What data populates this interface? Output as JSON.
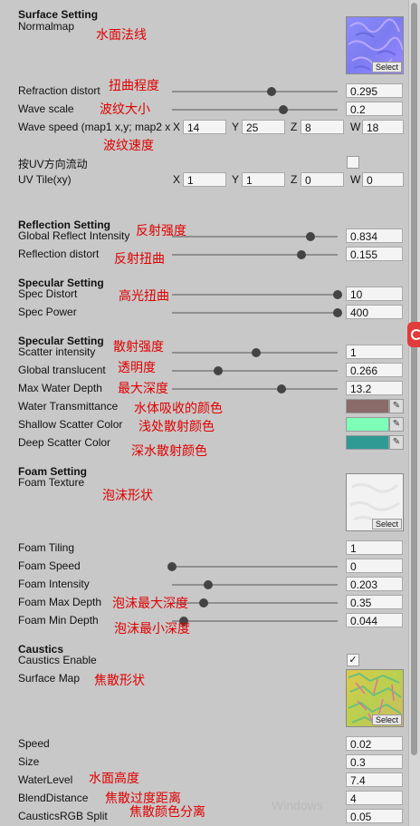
{
  "surface": {
    "header": "Surface Setting",
    "normalmap_label": "Normalmap",
    "normalmap_note": "水面法线",
    "select": "Select",
    "refraction": {
      "label": "Refraction distort",
      "note": "扭曲程度",
      "value": "0.295",
      "level": 0.6
    },
    "wave_scale": {
      "label": "Wave scale",
      "note": "波纹大小",
      "value": "0.2",
      "level": 0.67
    },
    "wave_speed": {
      "label": "Wave speed (map1 x,y; map2 x",
      "note": "波纹速度",
      "x": "14",
      "y": "25",
      "z": "8",
      "w": "18"
    },
    "uv_flow": {
      "label": "按UV方向流动"
    },
    "uv_tile": {
      "label": "UV Tile(xy)",
      "x": "1",
      "y": "1",
      "z": "0",
      "w": "0"
    },
    "axes": {
      "x": "X",
      "y": "Y",
      "z": "Z",
      "w": "W"
    }
  },
  "reflection": {
    "header": "Reflection Setting",
    "global": {
      "label": "Global Reflect Intensity",
      "note": "反射强度",
      "value": "0.834",
      "level": 0.834
    },
    "distort": {
      "label": "Reflection distort",
      "note": "反射扭曲",
      "value": "0.155",
      "level": 0.78
    }
  },
  "specular1": {
    "header": "Specular Setting",
    "distort": {
      "label": "Spec Distort",
      "note": "高光扭曲",
      "value": "10",
      "level": 1.0
    },
    "power": {
      "label": "Spec Power",
      "value": "400",
      "level": 1.0
    }
  },
  "specular2": {
    "header": "Specular Setting",
    "scatter": {
      "label": "Scatter intensity",
      "note": "散射强度",
      "value": "1",
      "level": 0.51
    },
    "translucent": {
      "label": "Global translucent",
      "note": "透明度",
      "value": "0.266",
      "level": 0.28
    },
    "depth": {
      "label": "Max Water Depth",
      "note": "最大深度",
      "value": "13.2",
      "level": 0.66
    },
    "transmit": {
      "label": "Water Transmittance",
      "note": "水体吸收的颜色",
      "color": "#8b6a6a"
    },
    "shallow": {
      "label": "Shallow Scatter Color",
      "note": "浅处散射颜色",
      "color": "#7dffb8"
    },
    "deep": {
      "label": "Deep Scatter Color",
      "note": "深水散射颜色",
      "color": "#2e9a93"
    }
  },
  "foam": {
    "header": "Foam Setting",
    "texture_label": "Foam Texture",
    "texture_note": "泡沫形状",
    "tiling": {
      "label": "Foam Tiling",
      "value": "1"
    },
    "speed": {
      "label": "Foam Speed",
      "value": "0",
      "level": 0.0
    },
    "intensity": {
      "label": "Foam Intensity",
      "value": "0.203",
      "level": 0.22
    },
    "max_depth": {
      "label": "Foam Max Depth",
      "note": "泡沫最大深度",
      "value": "0.35",
      "level": 0.19
    },
    "min_depth": {
      "label": "Foam Min Depth",
      "note": "泡沫最小深度",
      "value": "0.044",
      "level": 0.07
    }
  },
  "caustics": {
    "header": "Caustics",
    "enable": {
      "label": "Caustics Enable",
      "check": "✓"
    },
    "surface_label": "Surface Map",
    "surface_note": "焦散形状",
    "speed": {
      "label": "Speed",
      "value": "0.02"
    },
    "size": {
      "label": "Size",
      "value": "0.3"
    },
    "water_level": {
      "label": "WaterLevel",
      "note": "水面高度",
      "value": "7.4"
    },
    "blend": {
      "label": "BlendDistance",
      "note": "焦散过度距离",
      "value": "4"
    },
    "rgb_split": {
      "label": "CausticsRGB Split",
      "note": "焦散颜色分离",
      "value": "0.05"
    }
  },
  "watermark": "Windows",
  "icons": {
    "picker": "eyedropper-icon",
    "bookmark": "bookmark-icon"
  }
}
